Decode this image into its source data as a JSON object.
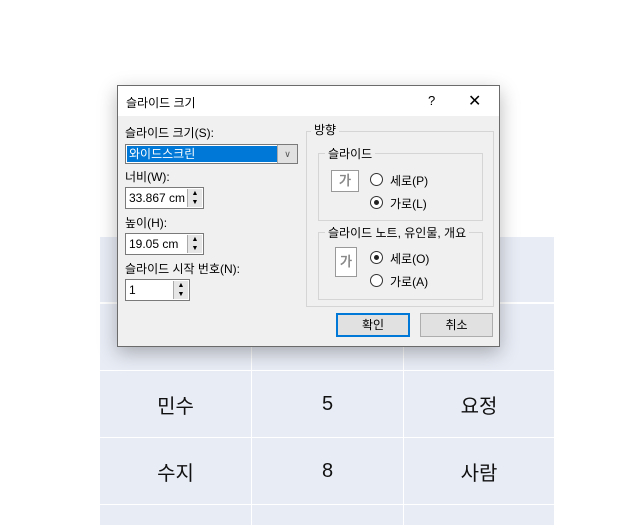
{
  "table": {
    "rows": [
      [
        "",
        "",
        ""
      ],
      [
        "",
        "",
        ""
      ],
      [
        "민수",
        "5",
        "요정"
      ],
      [
        "수지",
        "8",
        "사람"
      ],
      [
        "",
        "",
        ""
      ]
    ]
  },
  "dialog": {
    "title": "슬라이드 크기",
    "help": "?",
    "close": "✕",
    "size_label": "슬라이드 크기(S):",
    "size_value": "와이드스크린",
    "width_label": "너비(W):",
    "width_value": "33.867 cm",
    "height_label": "높이(H):",
    "height_value": "19.05 cm",
    "start_label": "슬라이드 시작 번호(N):",
    "start_value": "1",
    "orientation_label": "방향",
    "slides_group": "슬라이드",
    "slides_portrait": "세로(P)",
    "slides_landscape": "가로(L)",
    "slides_selected": "landscape",
    "notes_group": "슬라이드 노트, 유인물, 개요",
    "notes_portrait": "세로(O)",
    "notes_landscape": "가로(A)",
    "notes_selected": "portrait",
    "page_glyph": "가",
    "ok": "확인",
    "cancel": "취소"
  },
  "colors": {
    "accent": "#0078d7",
    "table_cell": "#e8ecf5"
  }
}
